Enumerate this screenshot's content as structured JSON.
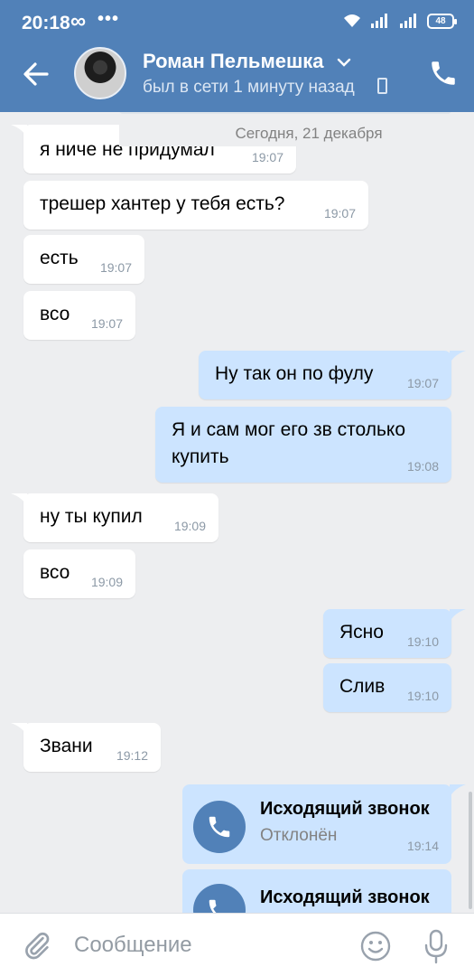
{
  "status_bar": {
    "time": "20:18",
    "infinity": "∞",
    "dots": "•••",
    "battery": "48"
  },
  "header": {
    "contact_name": "Роман Пельмешка",
    "contact_status": "был в сети 1 минуту назад",
    "back_icon": "arrow-left-icon",
    "call_icon": "phone-icon",
    "accent": "#5181b8"
  },
  "chat": {
    "date_label": "Сегодня, 21 декабря",
    "messages": [
      {
        "dir": "in",
        "text": "я ниче не придумал",
        "time": "19:07"
      },
      {
        "dir": "in",
        "text": "трешер хантер у тебя есть?",
        "time": "19:07"
      },
      {
        "dir": "in",
        "text": "есть",
        "time": "19:07"
      },
      {
        "dir": "in",
        "text": "всо",
        "time": "19:07"
      },
      {
        "dir": "out",
        "text": "Ну так он по фулу",
        "time": "19:07"
      },
      {
        "dir": "out",
        "text": "Я и сам мог его зв столько",
        "text2": "купить",
        "time": "19:08"
      },
      {
        "dir": "in",
        "text": "ну ты купил",
        "time": "19:09"
      },
      {
        "dir": "in",
        "text": "всо",
        "time": "19:09"
      },
      {
        "dir": "out",
        "text": "Ясно",
        "time": "19:10"
      },
      {
        "dir": "out",
        "text": "Слив",
        "time": "19:10"
      },
      {
        "dir": "in",
        "text": "Звани",
        "time": "19:12"
      }
    ],
    "calls": [
      {
        "title": "Исходящий звонок",
        "status": "Отклонён",
        "time": "19:14"
      },
      {
        "title": "Исходящий звонок"
      }
    ],
    "incoming_color": "#ffffff",
    "outgoing_color": "#cce4ff"
  },
  "composer": {
    "placeholder": "Сообщение",
    "attach_icon": "paperclip-icon",
    "emoji_icon": "smile-icon",
    "mic_icon": "microphone-icon"
  }
}
